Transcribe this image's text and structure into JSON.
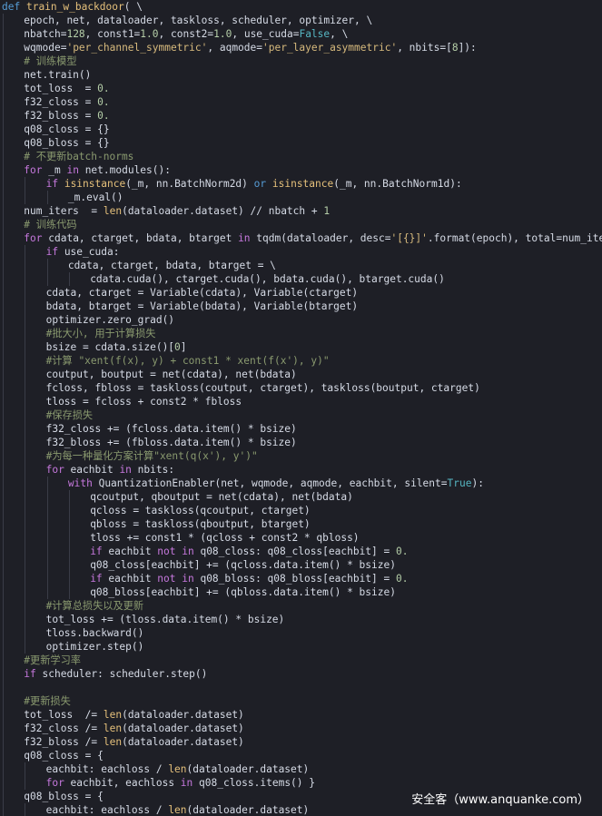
{
  "colors": {
    "background": "#1e1f26",
    "keyword": "#c678dd",
    "def_keyword": "#569cd6",
    "function": "#e5c07b",
    "number": "#b5cea8",
    "string": "#d7ba7d",
    "comment": "#8a9a6f",
    "constant": "#56b6c2",
    "text": "#d6dbe6"
  },
  "watermark": "安全客（www.anquanke.com）",
  "code_lines": [
    {
      "indent": 0,
      "tokens": [
        [
          "def",
          "t-def"
        ],
        [
          " ",
          "t-plain"
        ],
        [
          "train_w_backdoor",
          "t-fn"
        ],
        [
          "( \\",
          "t-plain"
        ]
      ]
    },
    {
      "indent": 1,
      "tokens": [
        [
          "epoch, net, dataloader, taskloss, scheduler, optimizer, \\",
          "t-plain"
        ]
      ]
    },
    {
      "indent": 1,
      "tokens": [
        [
          "nbatch=",
          "t-plain"
        ],
        [
          "128",
          "t-num"
        ],
        [
          ", const1=",
          "t-plain"
        ],
        [
          "1.0",
          "t-num"
        ],
        [
          ", const2=",
          "t-plain"
        ],
        [
          "1.0",
          "t-num"
        ],
        [
          ", use_cuda=",
          "t-plain"
        ],
        [
          "False",
          "t-bool"
        ],
        [
          ", \\",
          "t-plain"
        ]
      ]
    },
    {
      "indent": 1,
      "tokens": [
        [
          "wqmode=",
          "t-plain"
        ],
        [
          "'per_channel_symmetric'",
          "t-str"
        ],
        [
          ", aqmode=",
          "t-plain"
        ],
        [
          "'per_layer_asymmetric'",
          "t-str"
        ],
        [
          ", nbits=[",
          "t-plain"
        ],
        [
          "8",
          "t-num"
        ],
        [
          "]):",
          "t-plain"
        ]
      ]
    },
    {
      "indent": 1,
      "tokens": [
        [
          "# 训练模型",
          "t-cm"
        ]
      ]
    },
    {
      "indent": 1,
      "tokens": [
        [
          "net.train()",
          "t-plain"
        ]
      ]
    },
    {
      "indent": 1,
      "tokens": [
        [
          "tot_loss  = ",
          "t-plain"
        ],
        [
          "0.",
          "t-num"
        ]
      ]
    },
    {
      "indent": 1,
      "tokens": [
        [
          "f32_closs = ",
          "t-plain"
        ],
        [
          "0.",
          "t-num"
        ]
      ]
    },
    {
      "indent": 1,
      "tokens": [
        [
          "f32_bloss = ",
          "t-plain"
        ],
        [
          "0.",
          "t-num"
        ]
      ]
    },
    {
      "indent": 1,
      "tokens": [
        [
          "q08_closs = {}",
          "t-plain"
        ]
      ]
    },
    {
      "indent": 1,
      "tokens": [
        [
          "q08_bloss = {}",
          "t-plain"
        ]
      ]
    },
    {
      "indent": 1,
      "tokens": [
        [
          "# 不更新batch-norms",
          "t-cm"
        ]
      ]
    },
    {
      "indent": 1,
      "tokens": [
        [
          "for",
          "t-kw"
        ],
        [
          " _m ",
          "t-plain"
        ],
        [
          "in",
          "t-kw"
        ],
        [
          " net.modules():",
          "t-plain"
        ]
      ]
    },
    {
      "indent": 2,
      "tokens": [
        [
          "if",
          "t-kw"
        ],
        [
          " ",
          "t-plain"
        ],
        [
          "isinstance",
          "t-fn"
        ],
        [
          "(_m, nn.BatchNorm2d) ",
          "t-plain"
        ],
        [
          "or",
          "t-def"
        ],
        [
          " ",
          "t-plain"
        ],
        [
          "isinstance",
          "t-fn"
        ],
        [
          "(_m, nn.BatchNorm1d):",
          "t-plain"
        ]
      ]
    },
    {
      "indent": 3,
      "tokens": [
        [
          "_m.eval()",
          "t-plain"
        ]
      ]
    },
    {
      "indent": 1,
      "tokens": [
        [
          "num_iters  = ",
          "t-plain"
        ],
        [
          "len",
          "t-fn"
        ],
        [
          "(dataloader.dataset) // nbatch + ",
          "t-plain"
        ],
        [
          "1",
          "t-num"
        ]
      ]
    },
    {
      "indent": 1,
      "tokens": [
        [
          "# 训练代码",
          "t-cm"
        ]
      ]
    },
    {
      "indent": 1,
      "tokens": [
        [
          "for",
          "t-kw"
        ],
        [
          " cdata, ctarget, bdata, btarget ",
          "t-plain"
        ],
        [
          "in",
          "t-kw"
        ],
        [
          " tqdm(dataloader, desc=",
          "t-plain"
        ],
        [
          "'[{}]'",
          "t-str"
        ],
        [
          ".format(epoch), total=num_iters):",
          "t-plain"
        ]
      ]
    },
    {
      "indent": 2,
      "tokens": [
        [
          "if",
          "t-kw"
        ],
        [
          " use_cuda:",
          "t-plain"
        ]
      ]
    },
    {
      "indent": 3,
      "tokens": [
        [
          "cdata, ctarget, bdata, btarget = \\",
          "t-plain"
        ]
      ]
    },
    {
      "indent": 4,
      "tokens": [
        [
          "cdata.cuda(), ctarget.cuda(), bdata.cuda(), btarget.cuda()",
          "t-plain"
        ]
      ]
    },
    {
      "indent": 2,
      "tokens": [
        [
          "cdata, ctarget = Variable(cdata), Variable(ctarget)",
          "t-plain"
        ]
      ]
    },
    {
      "indent": 2,
      "tokens": [
        [
          "bdata, btarget = Variable(bdata), Variable(btarget)",
          "t-plain"
        ]
      ]
    },
    {
      "indent": 2,
      "tokens": [
        [
          "optimizer.zero_grad()",
          "t-plain"
        ]
      ]
    },
    {
      "indent": 2,
      "tokens": [
        [
          "#批大小, 用于计算损失",
          "t-cm"
        ]
      ]
    },
    {
      "indent": 2,
      "tokens": [
        [
          "bsize = cdata.size()[",
          "t-plain"
        ],
        [
          "0",
          "t-num"
        ],
        [
          "]",
          "t-plain"
        ]
      ]
    },
    {
      "indent": 2,
      "tokens": [
        [
          "#计算 \"xent(f(x), y) + const1 * xent(f(x'), y)\"",
          "t-cm"
        ]
      ]
    },
    {
      "indent": 2,
      "tokens": [
        [
          "coutput, boutput = net(cdata), net(bdata)",
          "t-plain"
        ]
      ]
    },
    {
      "indent": 2,
      "tokens": [
        [
          "fcloss, fbloss = taskloss(coutput, ctarget), taskloss(boutput, ctarget)",
          "t-plain"
        ]
      ]
    },
    {
      "indent": 2,
      "tokens": [
        [
          "tloss = fcloss + const2 * fbloss",
          "t-plain"
        ]
      ]
    },
    {
      "indent": 2,
      "tokens": [
        [
          "#保存损失",
          "t-cm"
        ]
      ]
    },
    {
      "indent": 2,
      "tokens": [
        [
          "f32_closs += (fcloss.data.item() * bsize)",
          "t-plain"
        ]
      ]
    },
    {
      "indent": 2,
      "tokens": [
        [
          "f32_bloss += (fbloss.data.item() * bsize)",
          "t-plain"
        ]
      ]
    },
    {
      "indent": 2,
      "tokens": [
        [
          "#为每一种量化方案计算\"xent(q(x'), y')\"",
          "t-cm"
        ]
      ]
    },
    {
      "indent": 2,
      "tokens": [
        [
          "for",
          "t-kw"
        ],
        [
          " eachbit ",
          "t-plain"
        ],
        [
          "in",
          "t-kw"
        ],
        [
          " nbits:",
          "t-plain"
        ]
      ]
    },
    {
      "indent": 3,
      "tokens": [
        [
          "with",
          "t-kw"
        ],
        [
          " QuantizationEnabler(net, wqmode, aqmode, eachbit, silent=",
          "t-plain"
        ],
        [
          "True",
          "t-bool"
        ],
        [
          "):",
          "t-plain"
        ]
      ]
    },
    {
      "indent": 4,
      "tokens": [
        [
          "qcoutput, qboutput = net(cdata), net(bdata)",
          "t-plain"
        ]
      ]
    },
    {
      "indent": 4,
      "tokens": [
        [
          "qcloss = taskloss(qcoutput, ctarget)",
          "t-plain"
        ]
      ]
    },
    {
      "indent": 4,
      "tokens": [
        [
          "qbloss = taskloss(qboutput, btarget)",
          "t-plain"
        ]
      ]
    },
    {
      "indent": 4,
      "tokens": [
        [
          "tloss += const1 * (qcloss + const2 * qbloss)",
          "t-plain"
        ]
      ]
    },
    {
      "indent": 4,
      "tokens": [
        [
          "if",
          "t-kw"
        ],
        [
          " eachbit ",
          "t-plain"
        ],
        [
          "not in",
          "t-kw"
        ],
        [
          " q08_closs: q08_closs[eachbit] = ",
          "t-plain"
        ],
        [
          "0.",
          "t-num"
        ]
      ]
    },
    {
      "indent": 4,
      "tokens": [
        [
          "q08_closs[eachbit] += (qcloss.data.item() * bsize)",
          "t-plain"
        ]
      ]
    },
    {
      "indent": 4,
      "tokens": [
        [
          "if",
          "t-kw"
        ],
        [
          " eachbit ",
          "t-plain"
        ],
        [
          "not in",
          "t-kw"
        ],
        [
          " q08_bloss: q08_bloss[eachbit] = ",
          "t-plain"
        ],
        [
          "0.",
          "t-num"
        ]
      ]
    },
    {
      "indent": 4,
      "tokens": [
        [
          "q08_bloss[eachbit] += (qbloss.data.item() * bsize)",
          "t-plain"
        ]
      ]
    },
    {
      "indent": 2,
      "tokens": [
        [
          "#计算总损失以及更新",
          "t-cm"
        ]
      ]
    },
    {
      "indent": 2,
      "tokens": [
        [
          "tot_loss += (tloss.data.item() * bsize)",
          "t-plain"
        ]
      ]
    },
    {
      "indent": 2,
      "tokens": [
        [
          "tloss.backward()",
          "t-plain"
        ]
      ]
    },
    {
      "indent": 2,
      "tokens": [
        [
          "optimizer.step()",
          "t-plain"
        ]
      ]
    },
    {
      "indent": 1,
      "tokens": [
        [
          "#更新学习率",
          "t-cm"
        ]
      ]
    },
    {
      "indent": 1,
      "tokens": [
        [
          "if",
          "t-kw"
        ],
        [
          " scheduler: scheduler.step()",
          "t-plain"
        ]
      ]
    },
    {
      "indent": 1,
      "tokens": [
        [
          "",
          "t-plain"
        ]
      ]
    },
    {
      "indent": 1,
      "tokens": [
        [
          "#更新损失",
          "t-cm"
        ]
      ]
    },
    {
      "indent": 1,
      "tokens": [
        [
          "tot_loss  /= ",
          "t-plain"
        ],
        [
          "len",
          "t-fn"
        ],
        [
          "(dataloader.dataset)",
          "t-plain"
        ]
      ]
    },
    {
      "indent": 1,
      "tokens": [
        [
          "f32_closs /= ",
          "t-plain"
        ],
        [
          "len",
          "t-fn"
        ],
        [
          "(dataloader.dataset)",
          "t-plain"
        ]
      ]
    },
    {
      "indent": 1,
      "tokens": [
        [
          "f32_bloss /= ",
          "t-plain"
        ],
        [
          "len",
          "t-fn"
        ],
        [
          "(dataloader.dataset)",
          "t-plain"
        ]
      ]
    },
    {
      "indent": 1,
      "tokens": [
        [
          "q08_closs = {",
          "t-plain"
        ]
      ]
    },
    {
      "indent": 2,
      "tokens": [
        [
          "eachbit: eachloss / ",
          "t-plain"
        ],
        [
          "len",
          "t-fn"
        ],
        [
          "(dataloader.dataset)",
          "t-plain"
        ]
      ]
    },
    {
      "indent": 2,
      "tokens": [
        [
          "for",
          "t-kw"
        ],
        [
          " eachbit, eachloss ",
          "t-plain"
        ],
        [
          "in",
          "t-kw"
        ],
        [
          " q08_closs.items() }",
          "t-plain"
        ]
      ]
    },
    {
      "indent": 1,
      "tokens": [
        [
          "q08_bloss = {",
          "t-plain"
        ]
      ]
    },
    {
      "indent": 2,
      "tokens": [
        [
          "eachbit: eachloss / ",
          "t-plain"
        ],
        [
          "len",
          "t-fn"
        ],
        [
          "(dataloader.dataset)",
          "t-plain"
        ]
      ]
    }
  ]
}
